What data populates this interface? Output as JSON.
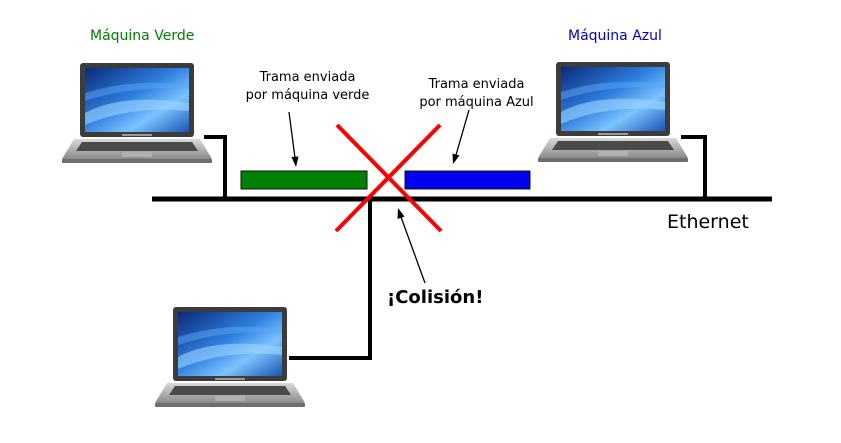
{
  "machines": {
    "green": {
      "name": "Máquina Verde",
      "color": "#008000",
      "frame_color": "#008000"
    },
    "blue": {
      "name": "Máquina Azul",
      "color": "#0000cc",
      "frame_color": "#0000ee"
    }
  },
  "frames": {
    "green_note": [
      "Trama enviada",
      "por máquina verde"
    ],
    "blue_note": [
      "Trama enviada",
      "por máquina Azul"
    ]
  },
  "network": {
    "label": "Ethernet"
  },
  "collision": {
    "label": "¡Colisión!",
    "mark_color": "#ff0000"
  },
  "icons": [
    "laptop-icon",
    "collision-cross-icon"
  ]
}
